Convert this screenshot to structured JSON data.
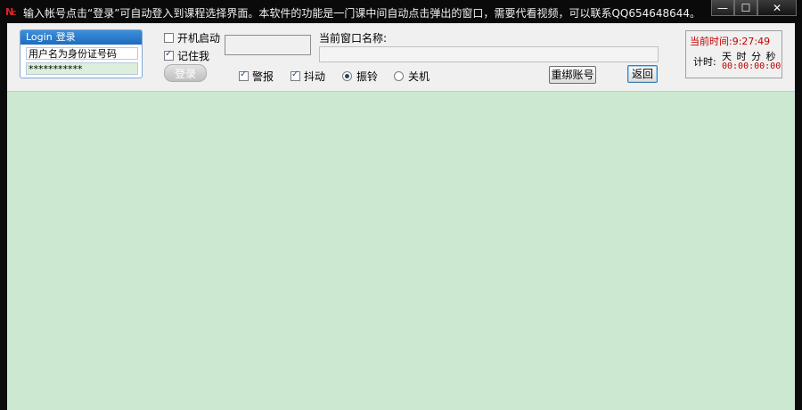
{
  "window": {
    "title": "输入帐号点击“登录”可自动登入到课程选择界面。本软件的功能是一门课中间自动点击弹出的窗口，需要代看视频，可以联系QQ654648644。",
    "minimize_glyph": "—",
    "maximize_glyph": "☐",
    "close_glyph": "✕"
  },
  "login": {
    "header_en": "Login",
    "header_cn": "登录",
    "username_value": "用户名为身份证号码",
    "password_value": "***********",
    "login_button": "登录"
  },
  "options": {
    "autostart_label": "开机启动",
    "autostart_checked": false,
    "remember_label": "记住我",
    "remember_checked": true
  },
  "window_name": {
    "label": "当前窗口名称:",
    "value": ""
  },
  "alerts": {
    "alarm_label": "警报",
    "alarm_checked": true,
    "shake_label": "抖动",
    "shake_checked": true,
    "ring_label": "振铃",
    "ring_selected": true,
    "shutdown_label": "关机",
    "shutdown_selected": false
  },
  "buttons": {
    "rebind_label": "重绑账号",
    "back_label": "返回"
  },
  "clock": {
    "current_label": "当前时间:",
    "current_value": "9:27:49",
    "timer_label": "计时:",
    "units": "天 时 分 秒",
    "timer_value": "00:00:00:00"
  },
  "colors": {
    "content_bg": "#cde8d1",
    "accent_red": "#c00000",
    "login_header_blue": "#1d6cbf"
  }
}
